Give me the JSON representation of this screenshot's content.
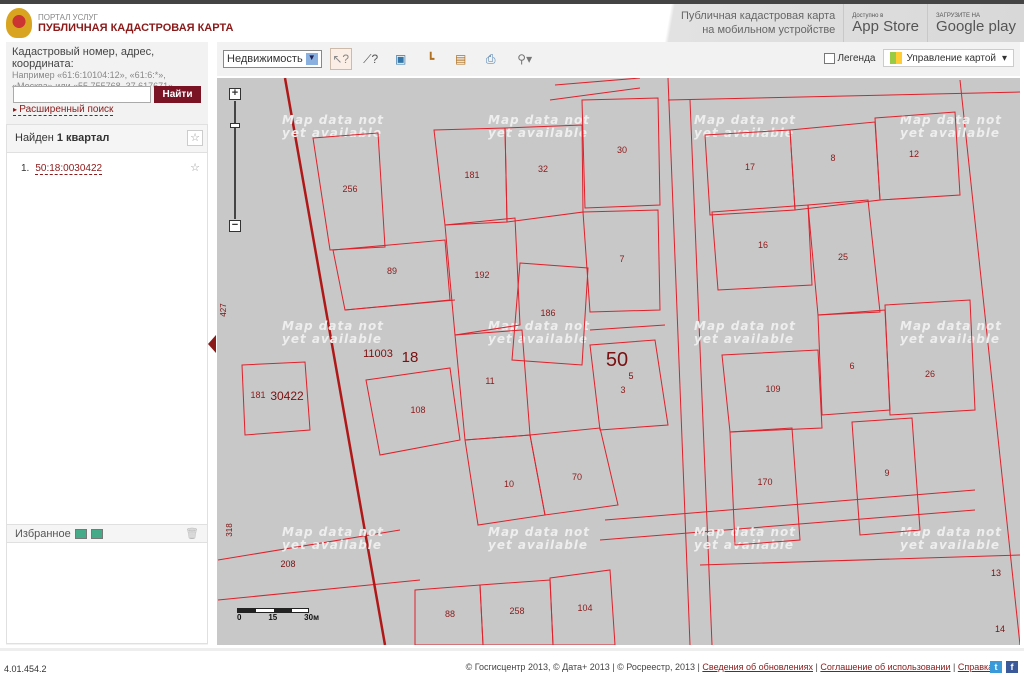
{
  "header": {
    "portal": "ПОРТАЛ УСЛУГ",
    "title": "ПУБЛИЧНАЯ КАДАСТРОВАЯ КАРТА",
    "mobile_line1": "Публичная кадастровая карта",
    "mobile_line2": "на мобильном устройстве",
    "appstore_small": "Доступно в",
    "appstore": "App Store",
    "gplay_small": "ЗАГРУЗИТЕ НА",
    "gplay": "Google play"
  },
  "search": {
    "label": "Кадастровый номер, адрес, координата:",
    "hint1": "Например «61:6:10104:12», «61:6:*»,",
    "hint2": "«Москва» или «55.755768, 37.617671»",
    "value": "",
    "button": "Найти",
    "advanced": "Расширенный поиск"
  },
  "results": {
    "found_prefix": "Найден ",
    "found_bold": "1 квартал",
    "items": [
      {
        "num": "1.",
        "label": "50:18:0030422"
      }
    ]
  },
  "favorites": {
    "label": "Избранное"
  },
  "toolbar": {
    "layer": "Недвижимость",
    "legend": "Легенда",
    "map_control": "Управление картой"
  },
  "map": {
    "no_data": "Map data not yet available",
    "parcels": [
      "256",
      "181",
      "32",
      "30",
      "89",
      "192",
      "186",
      "7",
      "11",
      "108",
      "181",
      "3",
      "10",
      "70",
      "17",
      "8",
      "12",
      "16",
      "25",
      "109",
      "6",
      "26",
      "170",
      "9",
      "88",
      "258",
      "104"
    ],
    "extra_labels": [
      "5",
      "11003",
      "18",
      "50",
      "30422",
      "427",
      "318",
      "208",
      "13",
      "14"
    ],
    "scale": [
      "0",
      "15",
      "30м"
    ]
  },
  "footer": {
    "version": "4.01.454.2",
    "copyright": "© Госгисцентр 2013, © Дата+ 2013 | © Росреестр, 2013 | ",
    "link_updates": "Сведения об обновлениях",
    "link_terms": "Соглашение об использовании",
    "link_help": "Справка"
  },
  "colors": {
    "accent": "#8b1a1a",
    "parcel": "#e0202a",
    "map_bg": "#c8c8c8"
  }
}
